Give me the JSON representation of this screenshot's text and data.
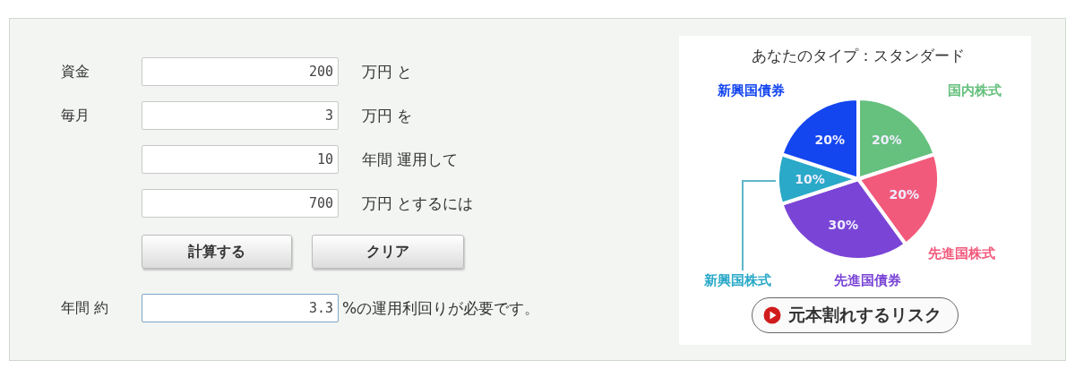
{
  "form": {
    "rows": [
      {
        "label": "資金",
        "value": "200",
        "suffix": "万円 と"
      },
      {
        "label": "毎月",
        "value": "3",
        "suffix": "万円 を"
      },
      {
        "label": "",
        "value": "10",
        "suffix": "年間 運用して"
      },
      {
        "label": "",
        "value": "700",
        "suffix": "万円 とするには"
      }
    ],
    "buttons": [
      "計算する",
      "クリア"
    ],
    "result": {
      "label": "年間 約",
      "value": "3.3",
      "suffix": "%の運用利回りが必要です。"
    }
  },
  "allocation": {
    "chart_data": {
      "type": "pie",
      "title": "あなたのタイプ：スタンダード",
      "categories": [
        "国内株式",
        "先進国株式",
        "先進国債券",
        "新興国株式",
        "新興国債券"
      ],
      "values": [
        20,
        20,
        30,
        10,
        20
      ],
      "colors": [
        "#66c07e",
        "#f25a7c",
        "#7a45d6",
        "#2aa9c8",
        "#1446f0"
      ],
      "value_labels": [
        "20%",
        "20%",
        "30%",
        "10%",
        "20%"
      ]
    },
    "risk_button": "元本割れするリスク"
  }
}
